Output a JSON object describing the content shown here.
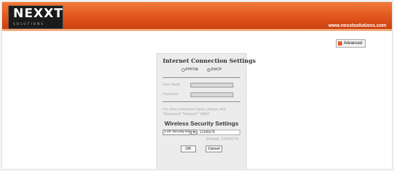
{
  "header": {
    "logo_text": "NEXXT",
    "logo_subtext": "SOLUTIONS",
    "site_url": "www.nexxtsolutions.com"
  },
  "toolbar": {
    "advanced_label": "Advanced"
  },
  "internet": {
    "title": "Internet Connection Settings",
    "pppoe_label": "PPPOE",
    "dhcp_label": "DHCP",
    "selected": "DHCP",
    "username_label": "User Name",
    "password_label": "Password",
    "note": "For other connection types, please click \"Advanced\" \"Network\" \"WAN\"."
  },
  "wireless": {
    "title": "Wireless Security Settings",
    "select_value": "2.4G Security Key",
    "key_value": "12345678",
    "default_text": "(Default: 12345678)"
  },
  "buttons": {
    "ok": "OK",
    "cancel": "Cancel"
  },
  "colors": {
    "header_orange": "#e0521c",
    "logo_bg": "#1b1b1b"
  }
}
